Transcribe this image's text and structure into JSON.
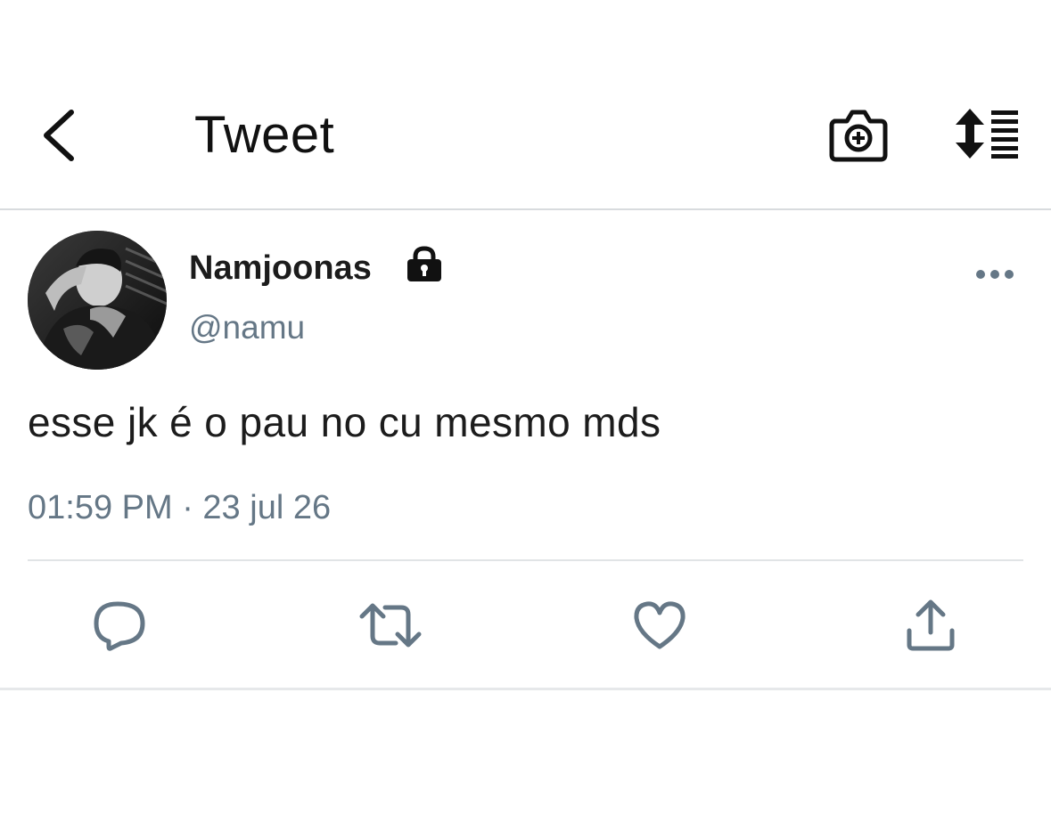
{
  "header": {
    "title": "Tweet",
    "back_icon": "chevron-left-icon",
    "camera_icon": "camera-plus-icon",
    "sort_icon": "sort-list-icon"
  },
  "tweet": {
    "author_name": "Namjoonas",
    "protected_icon": "lock-icon",
    "handle": "@namu",
    "text": "esse jk é o pau no cu mesmo mds",
    "timestamp": "01:59 PM · 23 jul 26",
    "more_icon": "more-dots-icon"
  },
  "actions": [
    {
      "name": "reply",
      "icon": "reply-icon"
    },
    {
      "name": "retweet",
      "icon": "retweet-icon"
    },
    {
      "name": "like",
      "icon": "heart-icon"
    },
    {
      "name": "share",
      "icon": "share-icon"
    }
  ],
  "colors": {
    "secondary_text": "#657786",
    "icon_gray": "#657786",
    "divider": "#e1e4e6"
  }
}
